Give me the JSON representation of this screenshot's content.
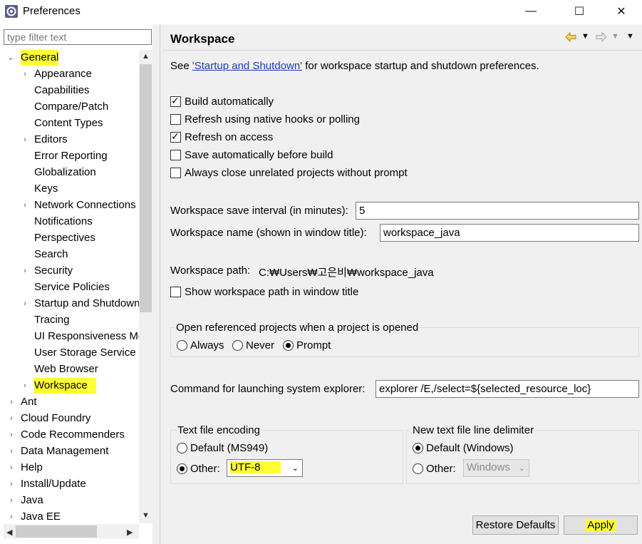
{
  "window": {
    "title": "Preferences",
    "minimize": "—",
    "maximize": "☐",
    "close": "✕"
  },
  "filter": {
    "placeholder": "type filter text"
  },
  "tree": {
    "general": "General",
    "children": [
      "Appearance",
      "Capabilities",
      "Compare/Patch",
      "Content Types",
      "Editors",
      "Error Reporting",
      "Globalization",
      "Keys",
      "Network Connections",
      "Notifications",
      "Perspectives",
      "Search",
      "Security",
      "Service Policies",
      "Startup and Shutdown",
      "Tracing",
      "UI Responsiveness Monitoring",
      "User Storage Service",
      "Web Browser",
      "Workspace"
    ],
    "top": [
      "Ant",
      "Cloud Foundry",
      "Code Recommenders",
      "Data Management",
      "Help",
      "Install/Update",
      "Java",
      "Java EE"
    ]
  },
  "page": {
    "title": "Workspace",
    "intro_prefix": "See ",
    "intro_link": "'Startup and Shutdown'",
    "intro_suffix": " for workspace startup and shutdown preferences.",
    "checks": [
      {
        "label": "Build automatically",
        "checked": true
      },
      {
        "label": "Refresh using native hooks or polling",
        "checked": false
      },
      {
        "label": "Refresh on access",
        "checked": true
      },
      {
        "label": "Save automatically before build",
        "checked": false
      },
      {
        "label": "Always close unrelated projects without prompt",
        "checked": false
      }
    ],
    "save_interval_label": "Workspace save interval (in minutes):",
    "save_interval_value": "5",
    "ws_name_label": "Workspace name (shown in window title):",
    "ws_name_value": "workspace_java",
    "ws_path_label": "Workspace path:",
    "ws_path_value": "C:₩Users₩고은비₩workspace_java",
    "show_path_label": "Show workspace path in window title",
    "open_ref_title": "Open referenced projects when a project is opened",
    "open_ref_options": [
      "Always",
      "Never",
      "Prompt"
    ],
    "explorer_label": "Command for launching system explorer:",
    "explorer_value": "explorer /E,/select=${selected_resource_loc}",
    "encoding_title": "Text file encoding",
    "encoding_default": "Default (MS949)",
    "encoding_other": "Other:",
    "encoding_value": "UTF-8",
    "delim_title": "New text file line delimiter",
    "delim_default": "Default (Windows)",
    "delim_other": "Other:",
    "delim_value": "Windows",
    "restore_label": "Restore Defaults",
    "apply_label": "Apply"
  },
  "colors": {
    "highlight": "#ffff33",
    "link": "#1a3fa8",
    "panel": "#f0f0f0"
  }
}
